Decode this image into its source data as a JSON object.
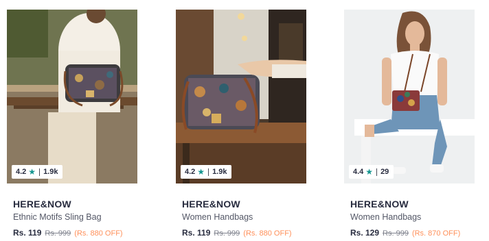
{
  "products": [
    {
      "brand": "HERE&NOW",
      "name": "Ethnic Motifs Sling Bag",
      "rating": "4.2",
      "rating_count": "1.9k",
      "price": "Rs. 119",
      "mrp": "Rs. 999",
      "discount": "(Rs. 880 OFF)",
      "image_icon": "woman-sitting-with-bag-photo"
    },
    {
      "brand": "HERE&NOW",
      "name": "Women Handbags",
      "rating": "4.2",
      "rating_count": "1.9k",
      "price": "Rs. 119",
      "mrp": "Rs. 999",
      "discount": "(Rs. 880 OFF)",
      "image_icon": "handbag-on-table-photo"
    },
    {
      "brand": "HERE&NOW",
      "name": "Women Handbags",
      "rating": "4.4",
      "rating_count": "29",
      "price": "Rs. 129",
      "mrp": "Rs. 999",
      "discount": "(Rs. 870 OFF)",
      "image_icon": "woman-with-crossbody-bag-photo"
    }
  ],
  "colors": {
    "star": "#14958f",
    "discount": "#ff905a",
    "brand": "#282c3f",
    "muted": "#7e818c"
  },
  "star_glyph": "★"
}
